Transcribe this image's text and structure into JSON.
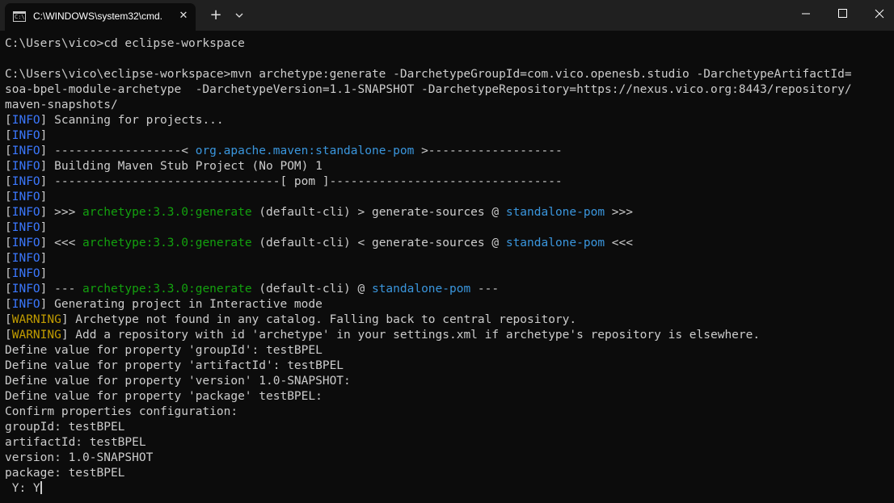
{
  "window": {
    "tab_title": "C:\\WINDOWS\\system32\\cmd.",
    "tab_icon": "cmd-icon",
    "new_tab_icon": "plus-icon",
    "dropdown_icon": "chevron-down-icon",
    "close_tab_icon": "close-icon",
    "caption_buttons": [
      "minimize-icon",
      "maximize-icon",
      "close-icon"
    ]
  },
  "colors": {
    "background": "#0c0c0c",
    "titlebar": "#202020",
    "text": "#cccccc",
    "info": "#3b78ff",
    "warning": "#c19c00",
    "green": "#13a10e",
    "cyan": "#3a96dd"
  },
  "console": {
    "lines": [
      [
        {
          "t": "C:\\Users\\vico>cd eclipse-workspace"
        }
      ],
      [],
      [
        {
          "t": "C:\\Users\\vico\\eclipse-workspace>mvn archetype:generate -DarchetypeGroupId=com.vico.openesb.studio -DarchetypeArtifactId="
        }
      ],
      [
        {
          "t": "soa-bpel-module-archetype  -DarchetypeVersion=1.1-SNAPSHOT -DarchetypeRepository=https://nexus.vico.org:8443/repository/"
        }
      ],
      [
        {
          "t": "maven-snapshots/"
        }
      ],
      [
        {
          "t": "["
        },
        {
          "t": "INFO",
          "c": "info"
        },
        {
          "t": "] Scanning for projects..."
        }
      ],
      [
        {
          "t": "["
        },
        {
          "t": "INFO",
          "c": "info"
        },
        {
          "t": "]"
        }
      ],
      [
        {
          "t": "["
        },
        {
          "t": "INFO",
          "c": "info"
        },
        {
          "t": "] ------------------< "
        },
        {
          "t": "org.apache.maven:standalone-pom",
          "c": "cyan"
        },
        {
          "t": " >-------------------"
        }
      ],
      [
        {
          "t": "["
        },
        {
          "t": "INFO",
          "c": "info"
        },
        {
          "t": "] Building Maven Stub Project (No POM) 1"
        }
      ],
      [
        {
          "t": "["
        },
        {
          "t": "INFO",
          "c": "info"
        },
        {
          "t": "] --------------------------------[ pom ]---------------------------------"
        }
      ],
      [
        {
          "t": "["
        },
        {
          "t": "INFO",
          "c": "info"
        },
        {
          "t": "]"
        }
      ],
      [
        {
          "t": "["
        },
        {
          "t": "INFO",
          "c": "info"
        },
        {
          "t": "] >>> "
        },
        {
          "t": "archetype:3.3.0:generate",
          "c": "green"
        },
        {
          "t": " (default-cli) > generate-sources @ "
        },
        {
          "t": "standalone-pom",
          "c": "cyan"
        },
        {
          "t": " >>>"
        }
      ],
      [
        {
          "t": "["
        },
        {
          "t": "INFO",
          "c": "info"
        },
        {
          "t": "]"
        }
      ],
      [
        {
          "t": "["
        },
        {
          "t": "INFO",
          "c": "info"
        },
        {
          "t": "] <<< "
        },
        {
          "t": "archetype:3.3.0:generate",
          "c": "green"
        },
        {
          "t": " (default-cli) < generate-sources @ "
        },
        {
          "t": "standalone-pom",
          "c": "cyan"
        },
        {
          "t": " <<<"
        }
      ],
      [
        {
          "t": "["
        },
        {
          "t": "INFO",
          "c": "info"
        },
        {
          "t": "]"
        }
      ],
      [
        {
          "t": "["
        },
        {
          "t": "INFO",
          "c": "info"
        },
        {
          "t": "]"
        }
      ],
      [
        {
          "t": "["
        },
        {
          "t": "INFO",
          "c": "info"
        },
        {
          "t": "] --- "
        },
        {
          "t": "archetype:3.3.0:generate",
          "c": "green"
        },
        {
          "t": " (default-cli) @ "
        },
        {
          "t": "standalone-pom",
          "c": "cyan"
        },
        {
          "t": " ---"
        }
      ],
      [
        {
          "t": "["
        },
        {
          "t": "INFO",
          "c": "info"
        },
        {
          "t": "] Generating project in Interactive mode"
        }
      ],
      [
        {
          "t": "["
        },
        {
          "t": "WARNING",
          "c": "warn"
        },
        {
          "t": "] Archetype not found in any catalog. Falling back to central repository."
        }
      ],
      [
        {
          "t": "["
        },
        {
          "t": "WARNING",
          "c": "warn"
        },
        {
          "t": "] Add a repository with id 'archetype' in your settings.xml if archetype's repository is elsewhere."
        }
      ],
      [
        {
          "t": "Define value for property 'groupId': testBPEL"
        }
      ],
      [
        {
          "t": "Define value for property 'artifactId': testBPEL"
        }
      ],
      [
        {
          "t": "Define value for property 'version' 1.0-SNAPSHOT:"
        }
      ],
      [
        {
          "t": "Define value for property 'package' testBPEL:"
        }
      ],
      [
        {
          "t": "Confirm properties configuration:"
        }
      ],
      [
        {
          "t": "groupId: testBPEL"
        }
      ],
      [
        {
          "t": "artifactId: testBPEL"
        }
      ],
      [
        {
          "t": "version: 1.0-SNAPSHOT"
        }
      ],
      [
        {
          "t": "package: testBPEL"
        }
      ],
      [
        {
          "t": " Y: Y"
        },
        {
          "cursor": true
        }
      ]
    ]
  }
}
